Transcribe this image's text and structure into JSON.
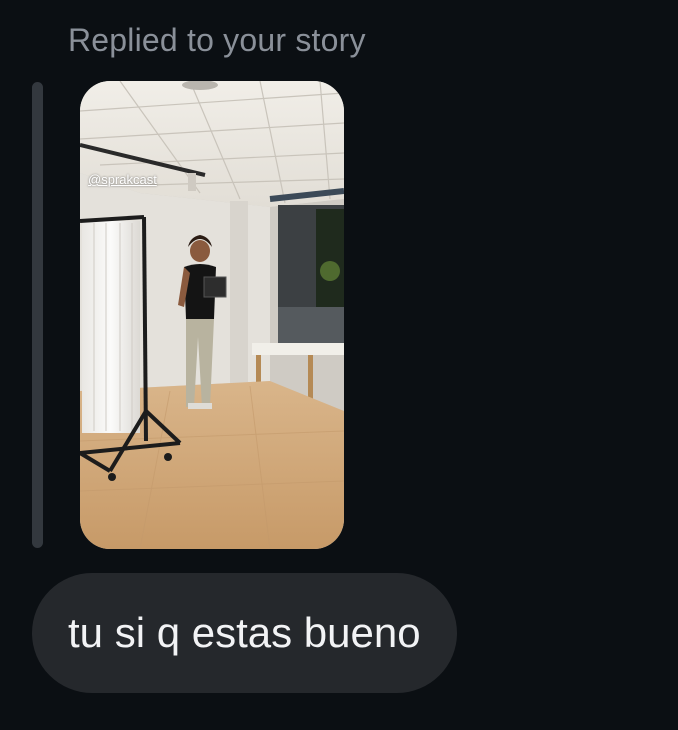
{
  "reply": {
    "label": "Replied to your story"
  },
  "story": {
    "mention": "@sprakcast"
  },
  "message": {
    "text": "tu si q estas bueno"
  },
  "colors": {
    "background": "#0b0f13",
    "label": "#8a9099",
    "bubble": "#25282c",
    "bubble_text": "#f2f3f5",
    "quote_bar": "#33383e"
  }
}
